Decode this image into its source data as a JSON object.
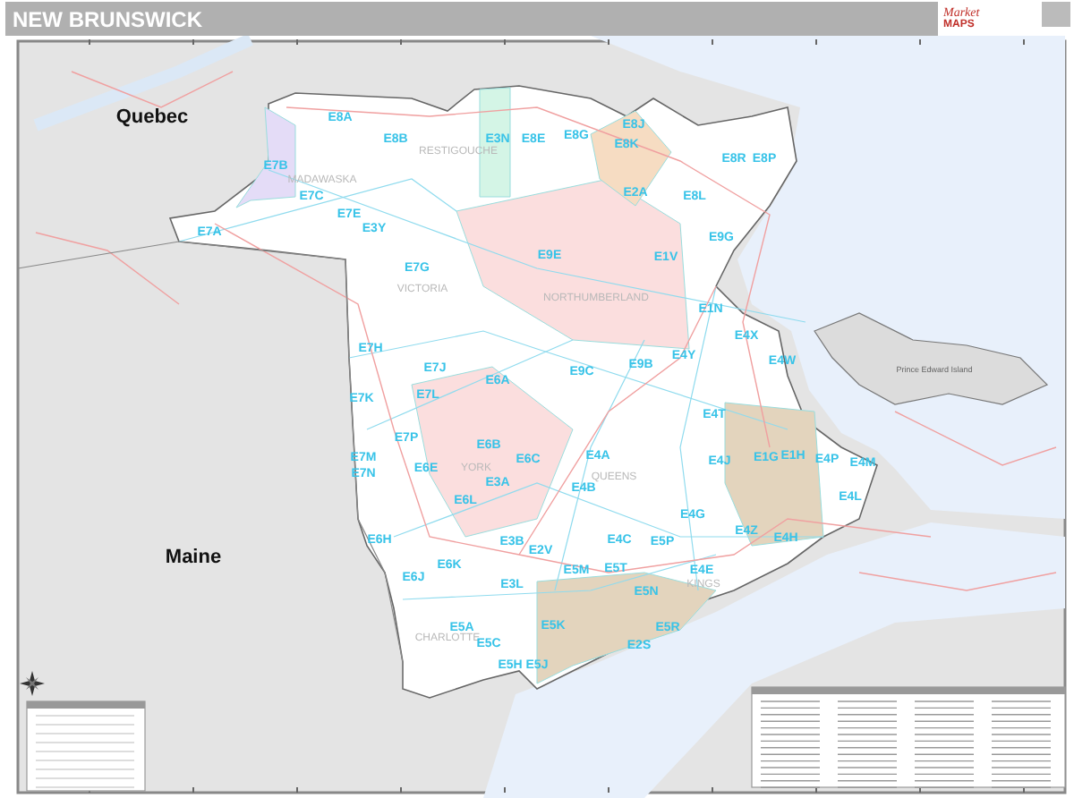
{
  "title": "NEW BRUNSWICK",
  "logo": {
    "brand": "Market",
    "sub": "MAPS"
  },
  "map": {
    "regions": [
      {
        "label": "Quebec"
      },
      {
        "label": "Maine"
      }
    ],
    "counties": [
      {
        "label": "RESTIGOUCHE"
      },
      {
        "label": "MADAWASKA"
      },
      {
        "label": "VICTORIA"
      },
      {
        "label": "NORTHUMBERLAND"
      },
      {
        "label": "YORK"
      },
      {
        "label": "QUEENS"
      },
      {
        "label": "KINGS"
      },
      {
        "label": "CHARLOTTE"
      }
    ],
    "island_label": "Prince Edward Island",
    "postal_zones": [
      {
        "label": "E8A"
      },
      {
        "label": "E8B"
      },
      {
        "label": "E3N"
      },
      {
        "label": "E8E"
      },
      {
        "label": "E8G"
      },
      {
        "label": "E8J"
      },
      {
        "label": "E8K"
      },
      {
        "label": "E8R"
      },
      {
        "label": "E8P"
      },
      {
        "label": "E8L"
      },
      {
        "label": "E2A"
      },
      {
        "label": "E9G"
      },
      {
        "label": "E7B"
      },
      {
        "label": "E7C"
      },
      {
        "label": "E7E"
      },
      {
        "label": "E3Y"
      },
      {
        "label": "E7A"
      },
      {
        "label": "E7G"
      },
      {
        "label": "E9E"
      },
      {
        "label": "E1V"
      },
      {
        "label": "E1N"
      },
      {
        "label": "E7H"
      },
      {
        "label": "E7J"
      },
      {
        "label": "E6A"
      },
      {
        "label": "E9C"
      },
      {
        "label": "E9B"
      },
      {
        "label": "E4Y"
      },
      {
        "label": "E4X"
      },
      {
        "label": "E4W"
      },
      {
        "label": "E7K"
      },
      {
        "label": "E7L"
      },
      {
        "label": "E4T"
      },
      {
        "label": "E7P"
      },
      {
        "label": "E6B"
      },
      {
        "label": "E6C"
      },
      {
        "label": "E4A"
      },
      {
        "label": "E4J"
      },
      {
        "label": "E1G"
      },
      {
        "label": "E1H"
      },
      {
        "label": "E4P"
      },
      {
        "label": "E4M"
      },
      {
        "label": "E7M"
      },
      {
        "label": "E6E"
      },
      {
        "label": "E3A"
      },
      {
        "label": "E7N"
      },
      {
        "label": "E6L"
      },
      {
        "label": "E4B"
      },
      {
        "label": "E4L"
      },
      {
        "label": "E4G"
      },
      {
        "label": "E6H"
      },
      {
        "label": "E6K"
      },
      {
        "label": "E6J"
      },
      {
        "label": "E3B"
      },
      {
        "label": "E2V"
      },
      {
        "label": "E4C"
      },
      {
        "label": "E5P"
      },
      {
        "label": "E4Z"
      },
      {
        "label": "E4H"
      },
      {
        "label": "E5M"
      },
      {
        "label": "E5T"
      },
      {
        "label": "E4E"
      },
      {
        "label": "E3L"
      },
      {
        "label": "E5N"
      },
      {
        "label": "E5A"
      },
      {
        "label": "E5K"
      },
      {
        "label": "E5R"
      },
      {
        "label": "E5C"
      },
      {
        "label": "E2S"
      },
      {
        "label": "E5H"
      },
      {
        "label": "E5J"
      }
    ]
  }
}
